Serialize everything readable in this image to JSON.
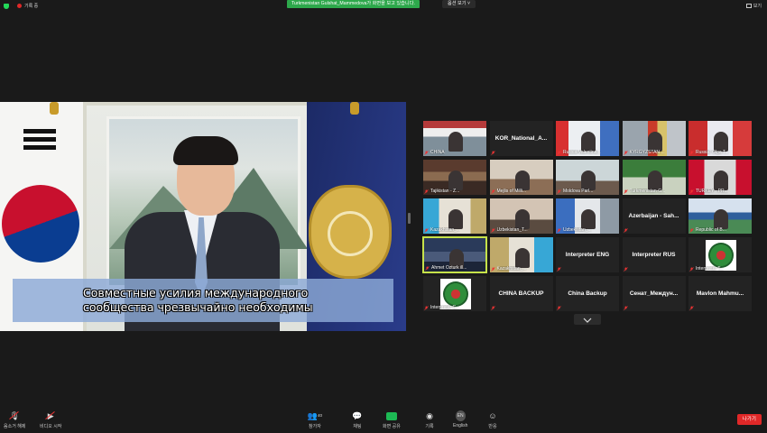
{
  "topbar": {
    "recording_label": "기록 중",
    "share_banner": "Turkmenistan Gulshat_Mammedova가 화면을 보고 있습니다.",
    "view_options": "옵션 보기 ˅",
    "view_button": "보기"
  },
  "main_video": {
    "subtitle_line1": "Совместные усилия международного",
    "subtitle_line2": "сообщества чрезвычайно необходимы"
  },
  "gallery": {
    "tiles": [
      {
        "name": "CHINA",
        "kind": "video",
        "scene": "banner"
      },
      {
        "name": "KOR_National_A...",
        "kind": "name_only"
      },
      {
        "name": "Russia-Valentina...",
        "kind": "video",
        "scene": "flags"
      },
      {
        "name": "KYRGYZSTAN ...",
        "kind": "video",
        "scene": "flags2"
      },
      {
        "name": "Russia. Olga T...",
        "kind": "video",
        "scene": "redflag"
      },
      {
        "name": "Tajikistan - Z...",
        "kind": "video",
        "scene": "hall"
      },
      {
        "name": "Mejlis of Milli...",
        "kind": "video",
        "scene": "room"
      },
      {
        "name": "Moldova Parl...",
        "kind": "video",
        "scene": "desk"
      },
      {
        "name": "Turkmenistan-G...",
        "kind": "video",
        "scene": "green"
      },
      {
        "name": "TURKEY - PR...",
        "kind": "video",
        "scene": "turkey"
      },
      {
        "name": "Kazakhstan_...",
        "kind": "video",
        "scene": "kz"
      },
      {
        "name": "Uzbekistan_T...",
        "kind": "video",
        "scene": "uz"
      },
      {
        "name": "Uzbekistan_...",
        "kind": "video",
        "scene": "uz2"
      },
      {
        "name": "Azerbaijan - Sah...",
        "kind": "name_only"
      },
      {
        "name": "Republic of B...",
        "kind": "video",
        "scene": "conf"
      },
      {
        "name": "Ahmet Ozturk ill...",
        "kind": "video",
        "scene": "group",
        "active": true
      },
      {
        "name": "Kazakhstan_...",
        "kind": "video",
        "scene": "kz2"
      },
      {
        "name": "Interpreter ENG",
        "kind": "name_only"
      },
      {
        "name": "Interpreter RUS",
        "kind": "name_only"
      },
      {
        "name": "Interpreter T...",
        "kind": "emblem"
      },
      {
        "name": "Interpreter C...",
        "kind": "emblem"
      },
      {
        "name": "CHINA BACKUP",
        "kind": "name_only"
      },
      {
        "name": "China Backup",
        "kind": "name_only"
      },
      {
        "name": "Сенат_Междун...",
        "kind": "name_only"
      },
      {
        "name": "Mavlon Mahmu...",
        "kind": "name_only"
      }
    ]
  },
  "toolbar": {
    "mute_label": "음소거 해제",
    "video_label": "비디오 시작",
    "participants_label": "참가자",
    "participants_count": "40",
    "chat_label": "채팅",
    "share_label": "화면 공유",
    "record_label": "기록",
    "language_label": "English",
    "language_icon_text": "EN",
    "reactions_label": "반응",
    "leave_label": "나가기"
  },
  "colors": {
    "background": "#1a1a1a",
    "share_green": "#2da84b",
    "leave_red": "#e02828",
    "active_border": "#c6e24a"
  }
}
